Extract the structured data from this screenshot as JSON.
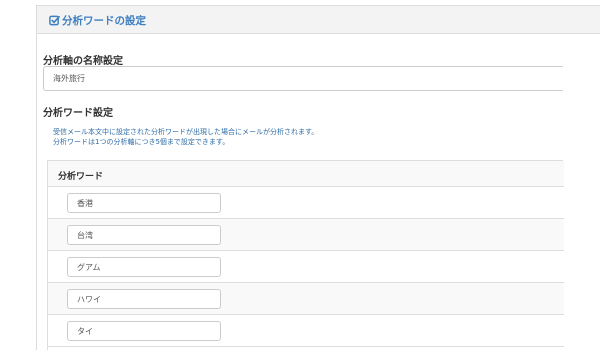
{
  "panel": {
    "title": "分析ワードの設定"
  },
  "axis_name": {
    "label": "分析軸の名称設定",
    "value": "海外旅行"
  },
  "word_settings": {
    "label": "分析ワード設定",
    "help_lines": [
      "受信メール本文中に設定された分析ワードが出現した場合にメールが分析されます。",
      "分析ワードは1つの分析軸につき5個まで設定できます。"
    ]
  },
  "table": {
    "header": "分析ワード",
    "rows": [
      {
        "value": "香港"
      },
      {
        "value": "台湾"
      },
      {
        "value": "グアム"
      },
      {
        "value": "ハワイ"
      },
      {
        "value": "タイ"
      }
    ]
  },
  "colors": {
    "accent": "#3e7fc1",
    "help_text": "#2e6ca8",
    "border": "#dddddd"
  },
  "icons": {
    "title_icon": "edit-check-icon"
  }
}
